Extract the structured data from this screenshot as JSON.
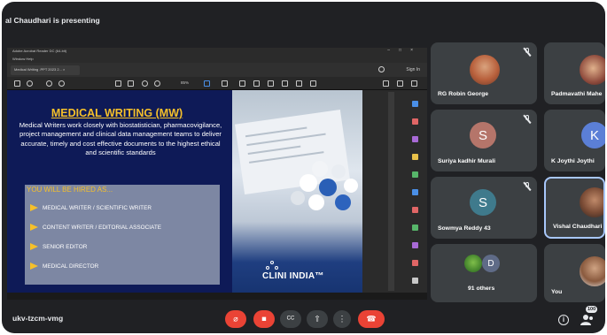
{
  "presenter_banner": "al Chaudhari is presenting",
  "meeting_code": "ukv-tzcm-vmg",
  "reader": {
    "window_title": "Adobe Acrobat Reader DC (64-bit)",
    "menu_text": "Window   Help",
    "tab_label": "Medical Writing .PPT 2023 2... ×",
    "sign_in": "Sign In",
    "zoom": "85%"
  },
  "slide": {
    "title": "MEDICAL WRITING (MW)",
    "body": "Medical Writers work closely with biostatistician, pharmacovigilance, project management and clinical data management teams to deliver accurate, timely and cost effective documents to the highest ethical and scientific standards",
    "hired_heading": "YOU WILL BE HIRED AS...",
    "roles": [
      "MEDICAL WRITER / SCIENTIFIC WRITER",
      "CONTENT WRITER / EDITORIAL ASSOCIATE",
      "SENIOR EDITOR",
      "MEDICAL DIRECTOR"
    ],
    "logo_text": "CLINI INDIA™"
  },
  "participants": [
    {
      "name": "RG Robin George",
      "muted": true,
      "avatar": "photo"
    },
    {
      "name": "Padmavathi Mahe",
      "muted": false,
      "avatar": "photo"
    },
    {
      "name": "Suriya kadhir Murali",
      "muted": true,
      "avatar": "S",
      "avatar_color": "#b5756a"
    },
    {
      "name": "K Joythi Joythi",
      "muted": false,
      "avatar": "K",
      "avatar_color": "#5b7fd6"
    },
    {
      "name": "Sowmya Reddy 43",
      "muted": true,
      "avatar": "S",
      "avatar_color": "#3f7a8c"
    },
    {
      "name": "Vishal Chaudhari",
      "muted": false,
      "avatar": "photo",
      "selected": true
    },
    {
      "name": "91 others",
      "muted": false,
      "avatar": "D",
      "avatar_color": "#5f6b87"
    },
    {
      "name": "You",
      "muted": false,
      "avatar": "photo"
    }
  ],
  "controls": {
    "mic": "mic-off",
    "camera": "camera-off",
    "captions": "CC",
    "present": "present",
    "more": "more",
    "end": "end-call",
    "people_count": "100"
  },
  "colors": {
    "meet_bg": "#202124",
    "tile_bg": "#3c4043",
    "danger": "#ea4335",
    "slide_bg": "#0e1a57",
    "accent_gold": "#f6c02a"
  }
}
